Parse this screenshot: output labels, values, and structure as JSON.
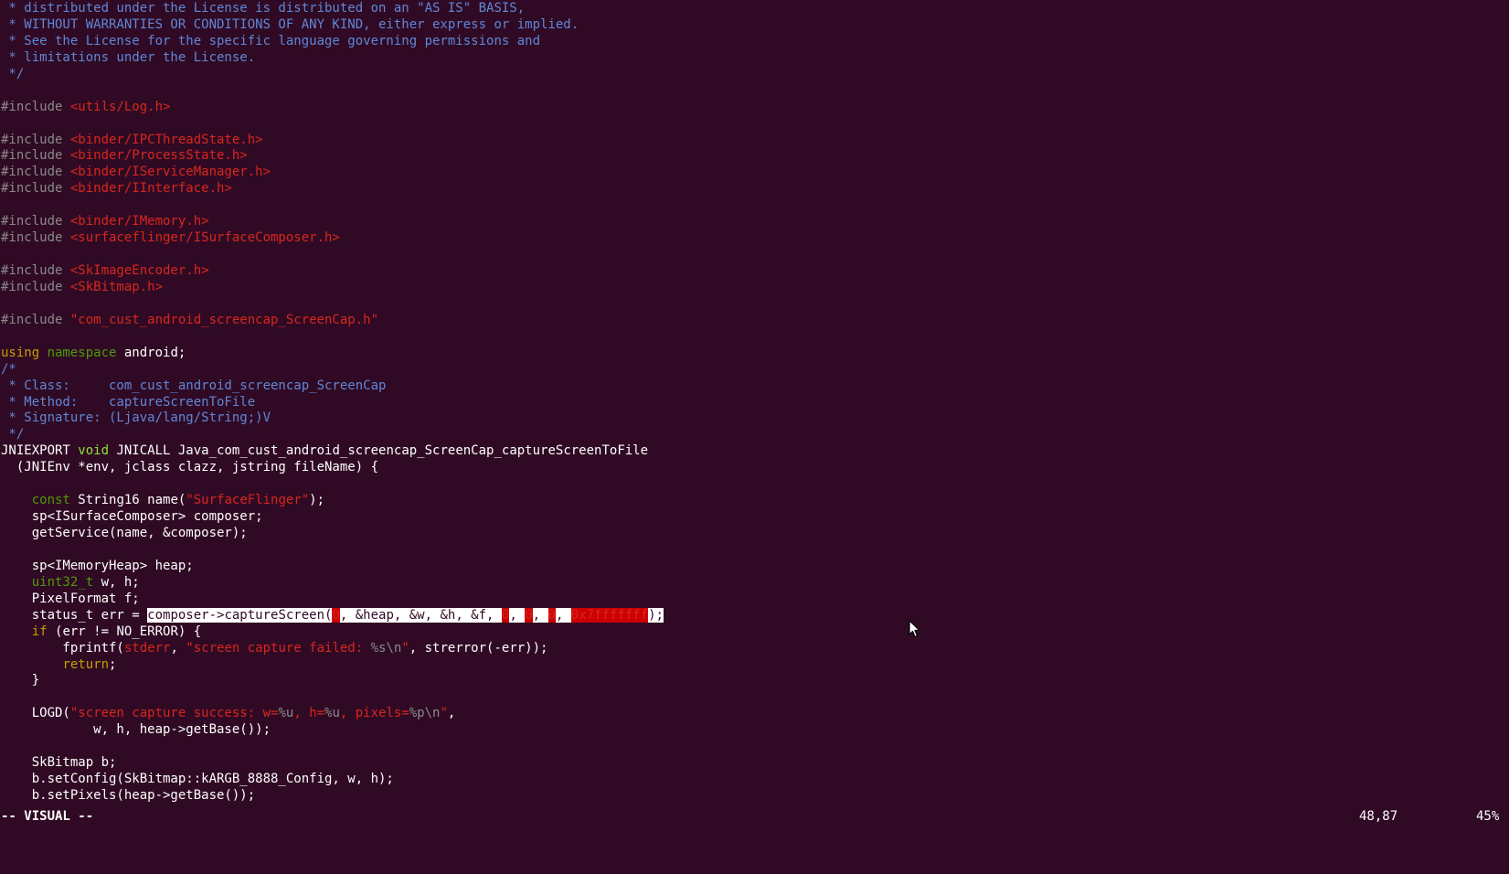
{
  "editor": {
    "mode": "vim",
    "lines": [
      [
        {
          "t": " * distributed under the License is distributed on an \"AS IS\" BASIS,",
          "c": "comment"
        }
      ],
      [
        {
          "t": " * WITHOUT WARRANTIES OR CONDITIONS OF ANY KIND, either express or implied.",
          "c": "comment"
        }
      ],
      [
        {
          "t": " * See the License for the specific language governing permissions and",
          "c": "comment"
        }
      ],
      [
        {
          "t": " * limitations under the License.",
          "c": "comment"
        }
      ],
      [
        {
          "t": " */",
          "c": "comment"
        }
      ],
      [],
      [
        {
          "t": "#include ",
          "c": "preproc"
        },
        {
          "t": "<utils/Log.h>",
          "c": "string"
        }
      ],
      [],
      [
        {
          "t": "#include ",
          "c": "preproc"
        },
        {
          "t": "<binder/IPCThreadState.h>",
          "c": "string"
        }
      ],
      [
        {
          "t": "#include ",
          "c": "preproc"
        },
        {
          "t": "<binder/ProcessState.h>",
          "c": "string"
        }
      ],
      [
        {
          "t": "#include ",
          "c": "preproc"
        },
        {
          "t": "<binder/IServiceManager.h>",
          "c": "string"
        }
      ],
      [
        {
          "t": "#include ",
          "c": "preproc"
        },
        {
          "t": "<binder/IInterface.h>",
          "c": "string"
        }
      ],
      [],
      [
        {
          "t": "#include ",
          "c": "preproc"
        },
        {
          "t": "<binder/IMemory.h>",
          "c": "string"
        }
      ],
      [
        {
          "t": "#include ",
          "c": "preproc"
        },
        {
          "t": "<surfaceflinger/ISurfaceComposer.h>",
          "c": "string"
        }
      ],
      [],
      [
        {
          "t": "#include ",
          "c": "preproc"
        },
        {
          "t": "<SkImageEncoder.h>",
          "c": "string"
        }
      ],
      [
        {
          "t": "#include ",
          "c": "preproc"
        },
        {
          "t": "<SkBitmap.h>",
          "c": "string"
        }
      ],
      [],
      [
        {
          "t": "#include ",
          "c": "preproc"
        },
        {
          "t": "\"com_cust_android_screencap_ScreenCap.h\"",
          "c": "string"
        }
      ],
      [],
      [
        {
          "t": "using ",
          "c": "keyword"
        },
        {
          "t": "namespace ",
          "c": "type2"
        },
        {
          "t": "android;",
          "c": "plain"
        }
      ],
      [
        {
          "t": "/*",
          "c": "comment"
        }
      ],
      [
        {
          "t": " * Class:     com_cust_android_screencap_ScreenCap",
          "c": "comment"
        }
      ],
      [
        {
          "t": " * Method:    captureScreenToFile",
          "c": "comment"
        }
      ],
      [
        {
          "t": " * Signature: (Ljava/lang/String;)V",
          "c": "comment"
        }
      ],
      [
        {
          "t": " */",
          "c": "comment"
        }
      ],
      [
        {
          "t": "JNIEXPORT ",
          "c": "plain"
        },
        {
          "t": "void ",
          "c": "type"
        },
        {
          "t": "JNICALL Java_com_cust_android_screencap_ScreenCap_captureScreenToFile",
          "c": "plain"
        }
      ],
      [
        {
          "t": "  (JNIEnv *env, jclass clazz, jstring fileName) {",
          "c": "plain"
        }
      ],
      [],
      [
        {
          "t": "    ",
          "c": "plain"
        },
        {
          "t": "const ",
          "c": "type2"
        },
        {
          "t": "String16 name(",
          "c": "plain"
        },
        {
          "t": "\"SurfaceFlinger\"",
          "c": "string"
        },
        {
          "t": ");",
          "c": "plain"
        }
      ],
      [
        {
          "t": "    sp<ISurfaceComposer> composer;",
          "c": "plain"
        }
      ],
      [
        {
          "t": "    getService(name, &composer);",
          "c": "plain"
        }
      ],
      [],
      [
        {
          "t": "    sp<IMemoryHeap> heap;",
          "c": "plain"
        }
      ],
      [
        {
          "t": "    ",
          "c": "plain"
        },
        {
          "t": "uint32_t ",
          "c": "type2"
        },
        {
          "t": "w, h;",
          "c": "plain"
        }
      ],
      [
        {
          "t": "    PixelFormat f;",
          "c": "plain"
        }
      ],
      [
        {
          "t": "    status_t err = ",
          "c": "plain"
        },
        {
          "t": "composer->captureScreen(",
          "c": "visual"
        },
        {
          "t": "0",
          "c": "visual-str"
        },
        {
          "t": ", &heap, &w, &h, &f, ",
          "c": "visual"
        },
        {
          "t": "0",
          "c": "visual-str"
        },
        {
          "t": ", ",
          "c": "visual"
        },
        {
          "t": "0",
          "c": "visual-str"
        },
        {
          "t": ", ",
          "c": "visual"
        },
        {
          "t": "0",
          "c": "visual-str"
        },
        {
          "t": ", ",
          "c": "visual"
        },
        {
          "t": "0x7fffffff",
          "c": "visual-str"
        },
        {
          "t": ");",
          "c": "visual"
        }
      ],
      [
        {
          "t": "    ",
          "c": "plain"
        },
        {
          "t": "if ",
          "c": "keyword"
        },
        {
          "t": "(err != NO_ERROR) {",
          "c": "plain"
        }
      ],
      [
        {
          "t": "        fprintf(",
          "c": "plain"
        },
        {
          "t": "stderr",
          "c": "string"
        },
        {
          "t": ", ",
          "c": "plain"
        },
        {
          "t": "\"screen capture failed: ",
          "c": "string"
        },
        {
          "t": "%s\\n",
          "c": "preproc"
        },
        {
          "t": "\"",
          "c": "string"
        },
        {
          "t": ", strerror(-err));",
          "c": "plain"
        }
      ],
      [
        {
          "t": "        ",
          "c": "plain"
        },
        {
          "t": "return",
          "c": "keyword"
        },
        {
          "t": ";",
          "c": "plain"
        }
      ],
      [
        {
          "t": "    }",
          "c": "plain"
        }
      ],
      [],
      [
        {
          "t": "    LOGD(",
          "c": "plain"
        },
        {
          "t": "\"screen capture success: w=",
          "c": "string"
        },
        {
          "t": "%u",
          "c": "preproc"
        },
        {
          "t": ", h=",
          "c": "string"
        },
        {
          "t": "%u",
          "c": "preproc"
        },
        {
          "t": ", pixels=",
          "c": "string"
        },
        {
          "t": "%p\\n",
          "c": "preproc"
        },
        {
          "t": "\"",
          "c": "string"
        },
        {
          "t": ",",
          "c": "plain"
        }
      ],
      [
        {
          "t": "            w, h, heap->getBase());",
          "c": "plain"
        }
      ],
      [],
      [
        {
          "t": "    SkBitmap b;",
          "c": "plain"
        }
      ],
      [
        {
          "t": "    b.setConfig(SkBitmap::kARGB_8888_Config, w, h);",
          "c": "plain"
        }
      ],
      [
        {
          "t": "    b.setPixels(heap->getBase());",
          "c": "plain"
        }
      ]
    ]
  },
  "status": {
    "mode_label": "-- VISUAL --",
    "cursor_position": "48,87",
    "scroll_percent": "45%"
  },
  "icons": {
    "mouse_pointer": "arrow-pointer-icon"
  }
}
